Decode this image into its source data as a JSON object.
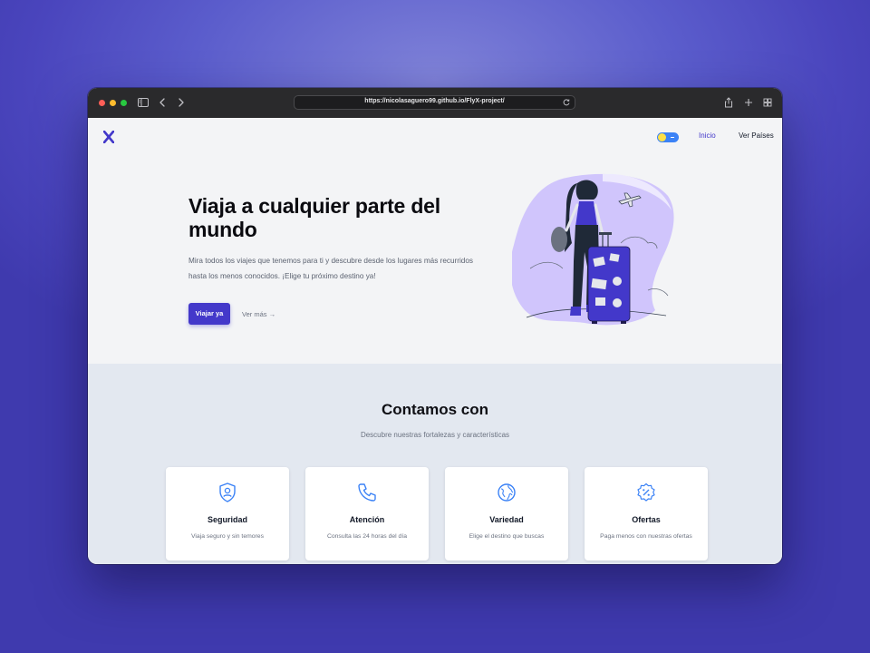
{
  "browser": {
    "url": "https://nicolasaguero99.github.io/FlyX-project/",
    "icons": [
      "sidebar-icon",
      "back-icon",
      "forward-icon",
      "reload-icon",
      "share-icon",
      "new-tab-icon",
      "tabs-overview-icon"
    ]
  },
  "nav": {
    "logo_icon": "flyx-logo-icon",
    "theme_toggle": "light",
    "links": [
      "Inicio",
      "Ver Países"
    ]
  },
  "hero": {
    "title": "Viaja a cualquier parte del mundo",
    "description": "Mira todos los viajes que tenemos para ti y descubre desde los lugares más recurridos hasta los menos conocidos. ¡Elige tu próximo destino ya!",
    "primary_button": "Viajar ya",
    "secondary_link": "Ver más →"
  },
  "features": {
    "title": "Contamos con",
    "subtitle": "Descubre nuestras fortalezas y características",
    "cards": [
      {
        "icon": "shield-user-icon",
        "title": "Seguridad",
        "desc": "Viaja seguro y sin temores"
      },
      {
        "icon": "phone-icon",
        "title": "Atención",
        "desc": "Consulta las 24 horas del día"
      },
      {
        "icon": "globe-icon",
        "title": "Variedad",
        "desc": "Elige el destino que buscas"
      },
      {
        "icon": "discount-badge-icon",
        "title": "Ofertas",
        "desc": "Paga menos con nuestras ofertas"
      }
    ]
  },
  "colors": {
    "accent": "#4338ca",
    "icon_blue": "#3b82f6",
    "hero_bg": "#f3f4f6",
    "features_bg": "#e3e8f0",
    "blob": "#c4b5fd"
  }
}
